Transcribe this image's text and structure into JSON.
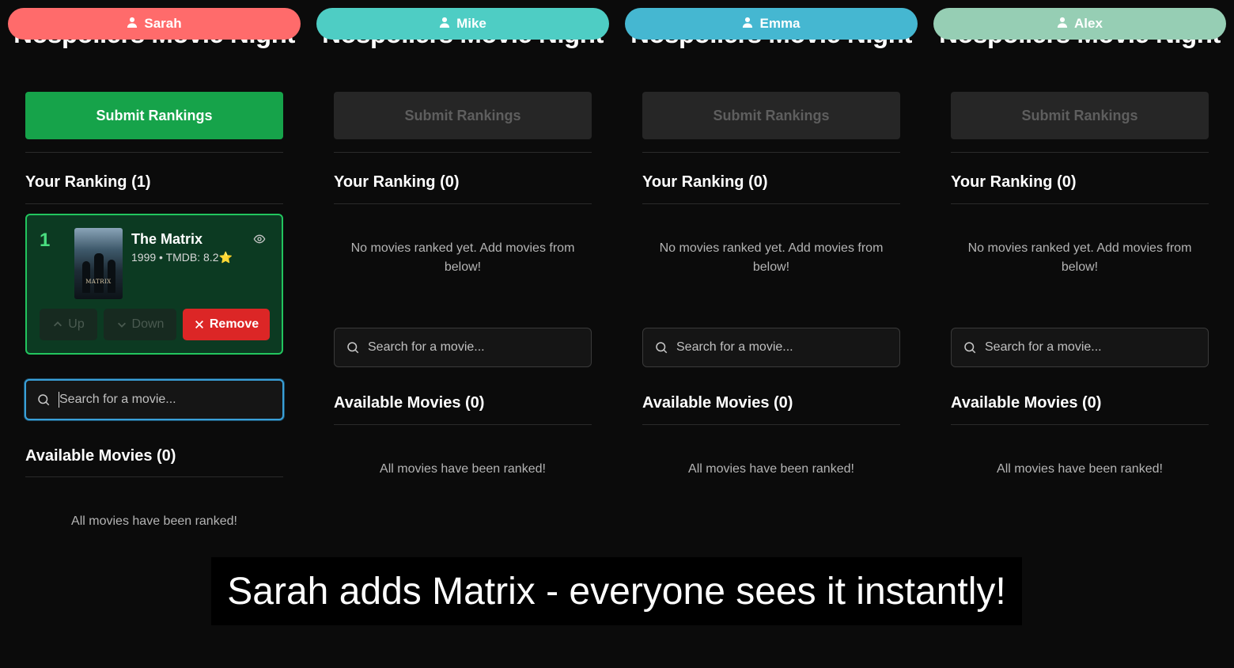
{
  "app": {
    "title": "Nospoilers Movie Night"
  },
  "colors": {
    "sarah": "#ff6b6b",
    "mike": "#4ecdc4",
    "emma": "#45b7d1",
    "alex": "#96ceb4",
    "accent_green": "#16a34a",
    "remove_red": "#dc2626"
  },
  "panels": [
    {
      "user": "Sarah",
      "submit_label": "Submit Rankings",
      "ranking_title": "Your Ranking (1)",
      "ranked": [
        {
          "rank": "1",
          "title": "The Matrix",
          "meta": "1999 • TMDB: 8.2⭐",
          "poster_text": "MATRIX"
        }
      ],
      "controls": {
        "up": "Up",
        "down": "Down",
        "remove": "Remove"
      },
      "search_placeholder": "Search for a movie...",
      "available_title": "Available Movies (0)",
      "available_empty": "All movies have been ranked!"
    },
    {
      "user": "Mike",
      "submit_label": "Submit Rankings",
      "ranking_title": "Your Ranking (0)",
      "ranking_empty": "No movies ranked yet. Add movies from below!",
      "search_placeholder": "Search for a movie...",
      "available_title": "Available Movies (0)",
      "available_empty": "All movies have been ranked!"
    },
    {
      "user": "Emma",
      "submit_label": "Submit Rankings",
      "ranking_title": "Your Ranking (0)",
      "ranking_empty": "No movies ranked yet. Add movies from below!",
      "search_placeholder": "Search for a movie...",
      "available_title": "Available Movies (0)",
      "available_empty": "All movies have been ranked!"
    },
    {
      "user": "Alex",
      "submit_label": "Submit Rankings",
      "ranking_title": "Your Ranking (0)",
      "ranking_empty": "No movies ranked yet. Add movies from below!",
      "search_placeholder": "Search for a movie...",
      "available_title": "Available Movies (0)",
      "available_empty": "All movies have been ranked!"
    }
  ],
  "caption": "Sarah adds Matrix - everyone sees it instantly!"
}
